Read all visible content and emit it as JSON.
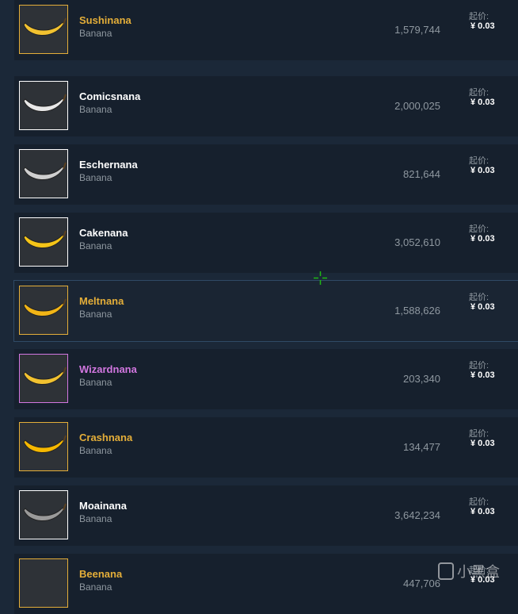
{
  "price_label": "起价:",
  "items": [
    {
      "name": "Sushinana",
      "type": "Banana",
      "quantity": "1,579,744",
      "price": "¥ 0.03",
      "name_color": "#e4ae39",
      "border_color": "#e4ae39",
      "icon": "sushi-banana-icon",
      "banana_color": "#f2c230"
    },
    {
      "name": "Comicsnana",
      "type": "Banana",
      "quantity": "2,000,025",
      "price": "¥ 0.03",
      "name_color": "#ffffff",
      "border_color": "#ffffff",
      "icon": "comic-banana-icon",
      "banana_color": "#e8e8e8"
    },
    {
      "name": "Eschernana",
      "type": "Banana",
      "quantity": "821,644",
      "price": "¥ 0.03",
      "name_color": "#ffffff",
      "border_color": "#ffffff",
      "icon": "escher-banana-icon",
      "banana_color": "#cfcfcf"
    },
    {
      "name": "Cakenana",
      "type": "Banana",
      "quantity": "3,052,610",
      "price": "¥ 0.03",
      "name_color": "#ffffff",
      "border_color": "#ffffff",
      "icon": "cake-banana-icon",
      "banana_color": "#f5c518"
    },
    {
      "name": "Meltnana",
      "type": "Banana",
      "quantity": "1,588,626",
      "price": "¥ 0.03",
      "name_color": "#e4ae39",
      "border_color": "#e4ae39",
      "icon": "melted-banana-icon",
      "banana_color": "#f2b516"
    },
    {
      "name": "Wizardnana",
      "type": "Banana",
      "quantity": "203,340",
      "price": "¥ 0.03",
      "name_color": "#d277e0",
      "border_color": "#d277e0",
      "icon": "wizard-banana-icon",
      "banana_color": "#f2c230"
    },
    {
      "name": "Crashnana",
      "type": "Banana",
      "quantity": "134,477",
      "price": "¥ 0.03",
      "name_color": "#e4ae39",
      "border_color": "#e4ae39",
      "icon": "crash-banana-icon",
      "banana_color": "#f5b800"
    },
    {
      "name": "Moainana",
      "type": "Banana",
      "quantity": "3,642,234",
      "price": "¥ 0.03",
      "name_color": "#ffffff",
      "border_color": "#ffffff",
      "icon": "moai-banana-icon",
      "banana_color": "#9a9a9a"
    },
    {
      "name": "Beenana",
      "type": "Banana",
      "quantity": "447,706",
      "price": "¥ 0.03",
      "name_color": "#e4ae39",
      "border_color": "#e4ae39",
      "icon": "bee-banana-icon",
      "banana_color": ""
    }
  ],
  "watermark": {
    "text": "小黑盒"
  },
  "cursor": {
    "icon": "crosshair-cursor-icon",
    "color": "#1fb814"
  }
}
